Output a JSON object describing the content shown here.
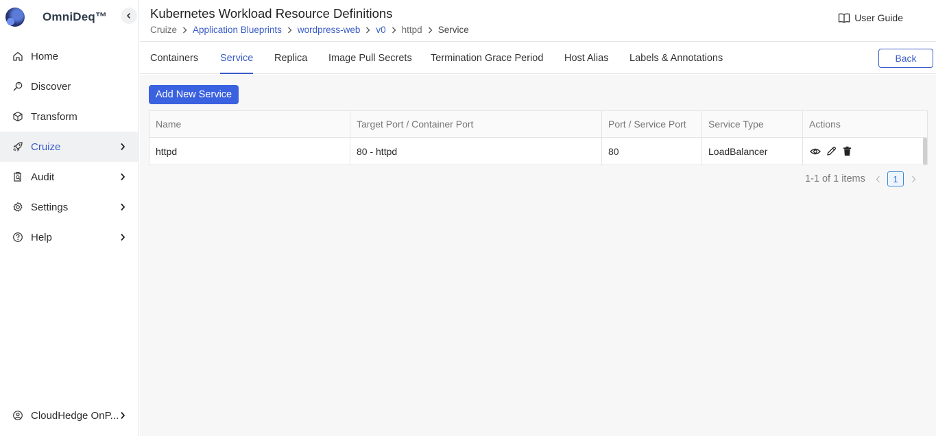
{
  "brand": {
    "name": "OmniDeq™"
  },
  "sidebar": {
    "items": [
      {
        "label": "Home",
        "icon": "home-icon"
      },
      {
        "label": "Discover",
        "icon": "discover-icon"
      },
      {
        "label": "Transform",
        "icon": "cube-icon"
      },
      {
        "label": "Cruize",
        "icon": "rocket-icon",
        "active": true
      },
      {
        "label": "Audit",
        "icon": "clipboard-search-icon"
      },
      {
        "label": "Settings",
        "icon": "gear-icon"
      },
      {
        "label": "Help",
        "icon": "help-circle-icon"
      }
    ],
    "bottom": {
      "label": "CloudHedge OnP...",
      "icon": "user-circle-icon"
    }
  },
  "header": {
    "title": "Kubernetes Workload Resource Definitions",
    "breadcrumb": [
      "Cruize",
      "Application Blueprints",
      "wordpress-web",
      "v0",
      "httpd",
      "Service"
    ],
    "user_guide_label": "User Guide"
  },
  "tabs": [
    "Containers",
    "Service",
    "Replica",
    "Image Pull Secrets",
    "Termination Grace Period",
    "Host Alias",
    "Labels & Annotations"
  ],
  "active_tab": "Service",
  "back_label": "Back",
  "content": {
    "add_button_label": "Add New Service",
    "table": {
      "columns": [
        "Name",
        "Target Port / Container Port",
        "Port / Service Port",
        "Service Type",
        "Actions"
      ],
      "rows": [
        {
          "name": "httpd",
          "target_port": "80 - httpd",
          "port": "80",
          "service_type": "LoadBalancer"
        }
      ]
    },
    "pagination": {
      "summary": "1-1 of 1 items",
      "current_page": "1"
    }
  },
  "colors": {
    "accent": "#3a5bc7",
    "primary_button": "#3a61e0"
  }
}
